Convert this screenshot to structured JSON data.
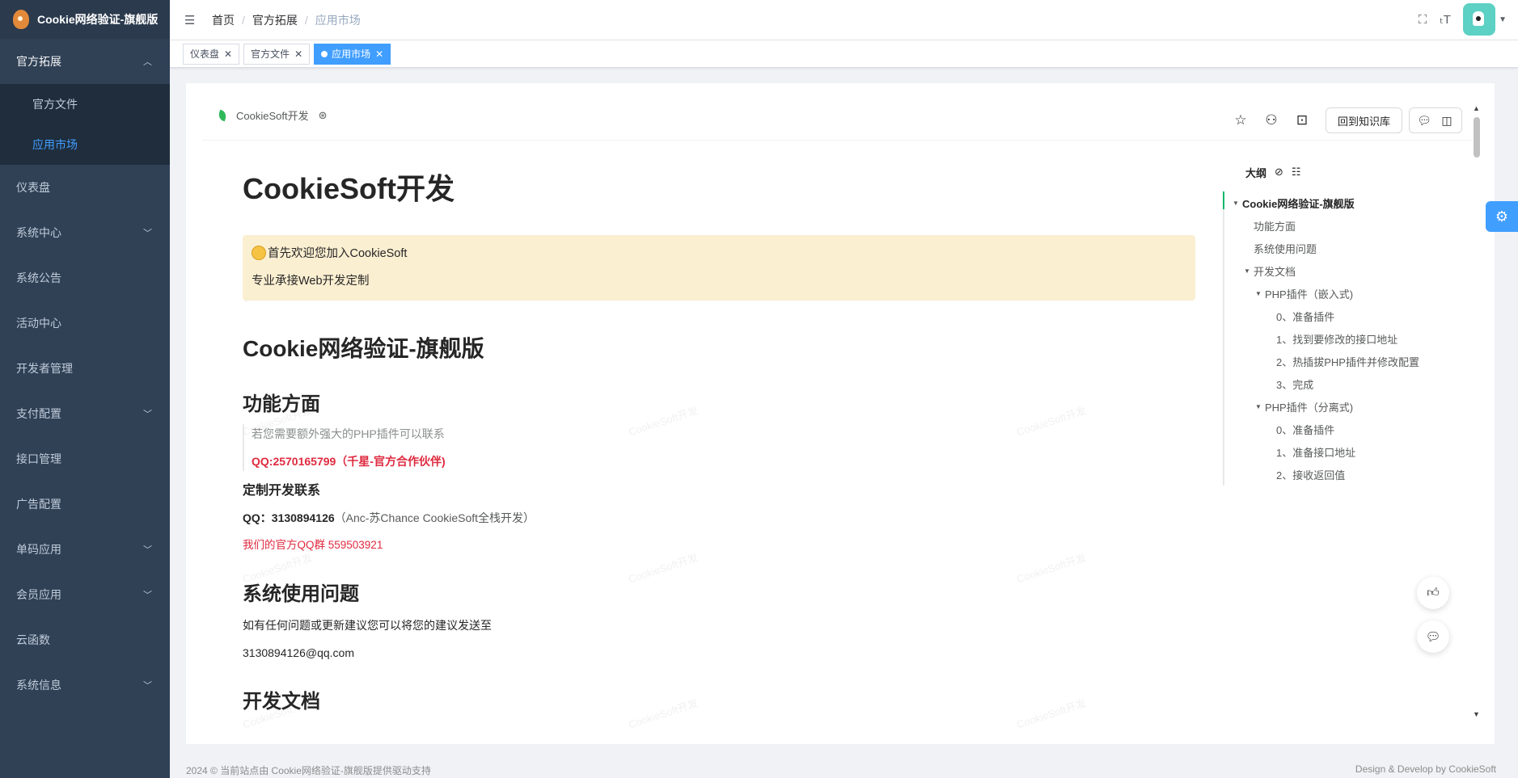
{
  "app": {
    "title": "Cookie网络验证-旗舰版"
  },
  "sidebar": {
    "items": [
      {
        "label": "官方拓展",
        "chevron": "chevron-up",
        "open": true,
        "children": [
          {
            "label": "官方文件"
          },
          {
            "label": "应用市场",
            "active": true
          }
        ]
      },
      {
        "label": "仪表盘"
      },
      {
        "label": "系统中心",
        "chevron": "chevron-down"
      },
      {
        "label": "系统公告"
      },
      {
        "label": "活动中心"
      },
      {
        "label": "开发者管理"
      },
      {
        "label": "支付配置",
        "chevron": "chevron-down"
      },
      {
        "label": "接口管理"
      },
      {
        "label": "广告配置"
      },
      {
        "label": "单码应用",
        "chevron": "chevron-down"
      },
      {
        "label": "会员应用",
        "chevron": "chevron-down"
      },
      {
        "label": "云函数"
      },
      {
        "label": "系统信息",
        "chevron": "chevron-down"
      }
    ]
  },
  "header": {
    "breadcrumb": [
      "首页",
      "官方拓展",
      "应用市场"
    ],
    "icons": [
      "fullscreen-icon",
      "font-size-icon",
      "avatar"
    ]
  },
  "tags": [
    {
      "label": "仪表盘"
    },
    {
      "label": "官方文件"
    },
    {
      "label": "应用市场",
      "active": true
    }
  ],
  "doc": {
    "kb_name": "CookieSoft开发",
    "back_button": "回到知识库",
    "title": "CookieSoft开发",
    "alert_line1": "首先欢迎您加入CookieSoft",
    "alert_line2": "专业承接Web开发定制",
    "h1": "Cookie网络验证-旗舰版",
    "section1": {
      "heading": "功能方面",
      "quote1": "若您需要额外强大的PHP插件可以联系",
      "quote2": "QQ:2570165799（千星-官方合作伙伴)",
      "sub_heading": "定制开发联系",
      "qq_label": "QQ：3130894126",
      "qq_note": "（Anc-苏Chance CookieSoft全栈开发）",
      "group": "我们的官方QQ群 559503921"
    },
    "section2": {
      "heading": "系统使用问题",
      "text": "如有任何问题或更新建议您可以将您的建议发送至",
      "email": "3130894126@qq.com"
    },
    "section3": {
      "heading": "开发文档"
    },
    "watermark": "CookieSoft开发"
  },
  "outline": {
    "title": "大纲",
    "items": [
      {
        "label": "Cookie网络验证-旗舰版",
        "level": 0,
        "tri": true,
        "active": true
      },
      {
        "label": "功能方面",
        "level": 1
      },
      {
        "label": "系统使用问题",
        "level": 1
      },
      {
        "label": "开发文档",
        "level": 1,
        "tri": true
      },
      {
        "label": "PHP插件（嵌入式)",
        "level": 2,
        "tri": true
      },
      {
        "label": "0、准备插件",
        "level": 3
      },
      {
        "label": "1、找到要修改的接口地址",
        "level": 3
      },
      {
        "label": "2、热插拔PHP插件并修改配置",
        "level": 3
      },
      {
        "label": "3、完成",
        "level": 3
      },
      {
        "label": "PHP插件（分离式)",
        "level": 2,
        "tri": true
      },
      {
        "label": "0、准备插件",
        "level": 3
      },
      {
        "label": "1、准备接口地址",
        "level": 3
      },
      {
        "label": "2、接收返回值",
        "level": 3
      }
    ]
  },
  "footer": {
    "left": "2024 © 当前站点由 Cookie网络验证-旗舰版提供驱动支持",
    "right": "Design & Develop by CookieSoft"
  },
  "colors": {
    "sidebar_bg": "#304156",
    "accent": "#409eff",
    "alert_bg": "#fbefd1",
    "red_text": "#df2a3f"
  }
}
